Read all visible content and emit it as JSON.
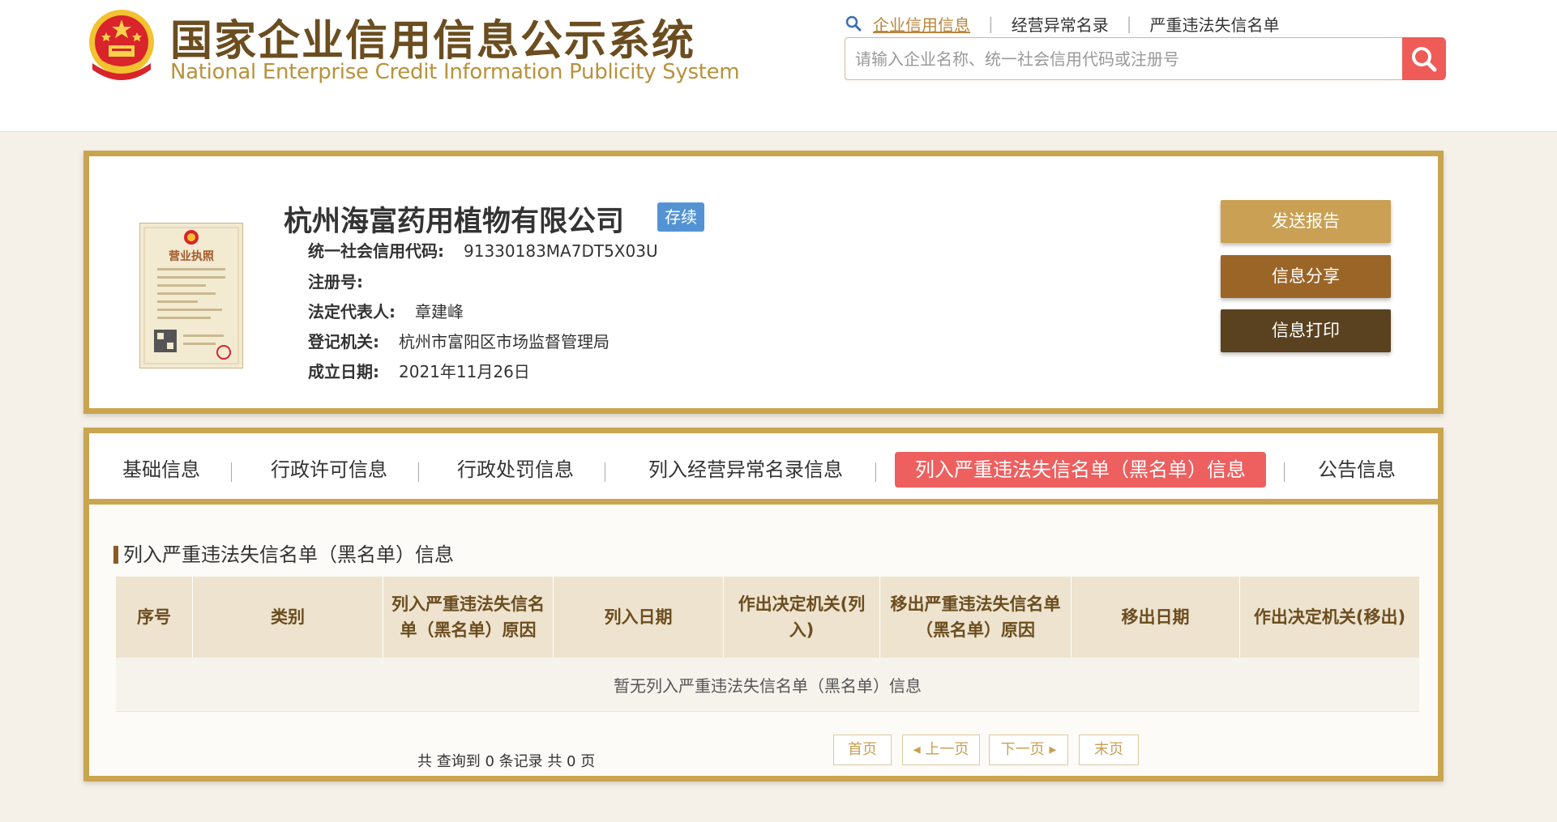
{
  "header": {
    "site_title": "国家企业信用信息公示系统",
    "site_subtitle": "National Enterprise Credit Information Publicity System",
    "nav": [
      {
        "label": "企业信用信息",
        "active": true
      },
      {
        "label": "经营异常名录",
        "active": false
      },
      {
        "label": "严重违法失信名单",
        "active": false
      }
    ],
    "search_placeholder": "请输入企业名称、统一社会信用代码或注册号"
  },
  "company": {
    "name": "杭州海富药用植物有限公司",
    "status": "存续",
    "fields": [
      {
        "label": "统一社会信用代码:",
        "value": "91330183MA7DT5X03U"
      },
      {
        "label": "注册号:",
        "value": ""
      },
      {
        "label": "法定代表人:",
        "value": "章建峰"
      },
      {
        "label": "登记机关:",
        "value": "杭州市富阳区市场监督管理局"
      },
      {
        "label": "成立日期:",
        "value": "2021年11月26日"
      }
    ],
    "license_title": "营业执照",
    "actions": {
      "send": "发送报告",
      "share": "信息分享",
      "print": "信息打印"
    }
  },
  "tabs": [
    {
      "label": "基础信息",
      "active": false
    },
    {
      "label": "行政许可信息",
      "active": false
    },
    {
      "label": "行政处罚信息",
      "active": false
    },
    {
      "label": "列入经营异常名录信息",
      "active": false
    },
    {
      "label": "列入严重违法失信名单（黑名单）信息",
      "active": true
    },
    {
      "label": "公告信息",
      "active": false
    }
  ],
  "section": {
    "title": "列入严重违法失信名单（黑名单）信息",
    "columns": [
      "序号",
      "类别",
      "列入严重违法失信名单（黑名单）原因",
      "列入日期",
      "作出决定机关(列入)",
      "移出严重违法失信名单（黑名单）原因",
      "移出日期",
      "作出决定机关(移出)"
    ],
    "empty_message": "暂无列入严重违法失信名单（黑名单）信息"
  },
  "pagination": {
    "summary": "共 查询到 0 条记录 共 0 页",
    "first": "首页",
    "prev": "上一页",
    "next": "下一页",
    "last": "末页"
  },
  "colors": {
    "gold_border": "#c9a54f",
    "title_brown": "#6b4d1f",
    "active_tab": "#ee5f5f",
    "status_blue": "#5393d4",
    "search_red": "#ef5b57"
  }
}
